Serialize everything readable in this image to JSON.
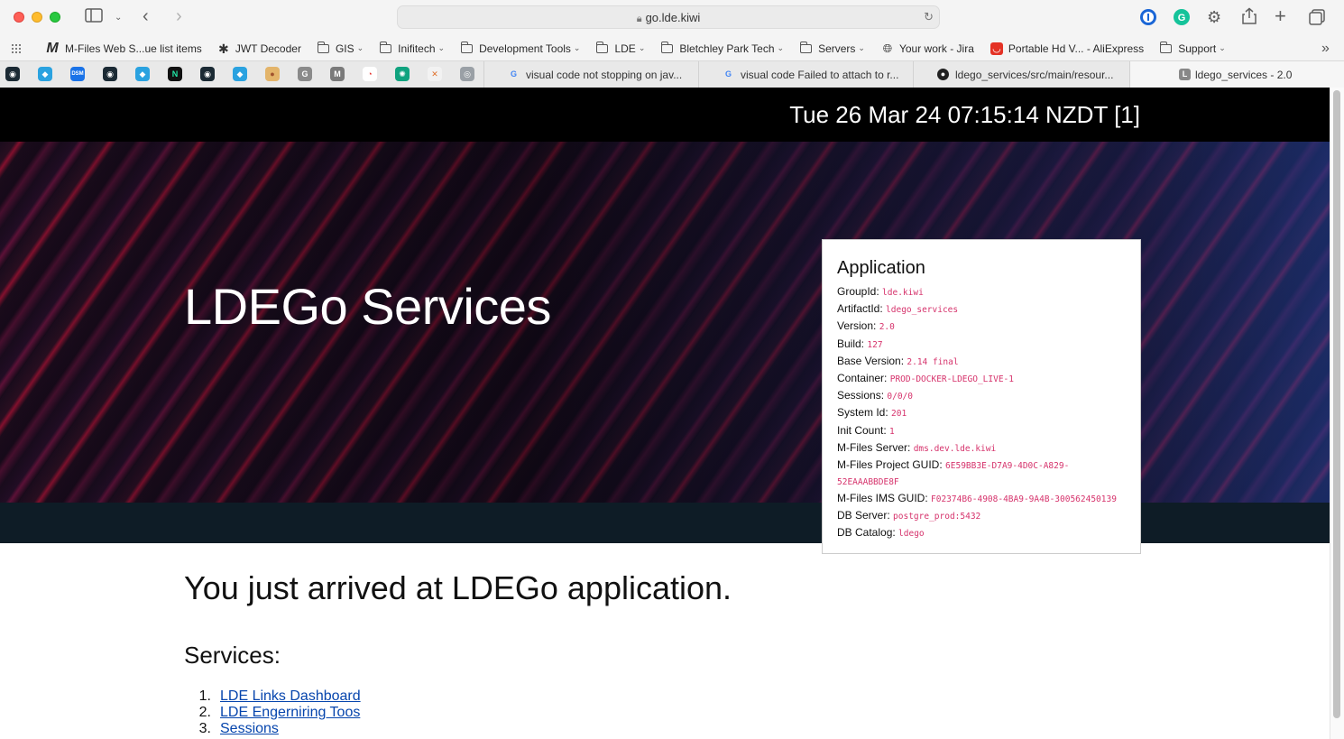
{
  "browser": {
    "url": "go.lde.kiwi",
    "bookmarks": [
      {
        "label": "M-Files Web S...ue list items",
        "icon": "m-files-logo-icon",
        "folder": false
      },
      {
        "label": "JWT Decoder",
        "icon": "jwt-icon",
        "folder": false
      },
      {
        "label": "GIS",
        "folder": true
      },
      {
        "label": "Inifitech",
        "folder": true
      },
      {
        "label": "Development Tools",
        "folder": true
      },
      {
        "label": "LDE",
        "folder": true
      },
      {
        "label": "Bletchley Park Tech",
        "folder": true
      },
      {
        "label": "Servers",
        "folder": true
      },
      {
        "label": "Your work - Jira",
        "icon": "globe-icon",
        "folder": false
      },
      {
        "label": "Portable Hd V... - AliExpress",
        "icon": "aliexpress-icon",
        "folder": false
      },
      {
        "label": "Support",
        "folder": true
      }
    ],
    "pinned_tabs": [
      {
        "name": "pinned-tab-1",
        "color": "#1b2a34",
        "glyph": "◉"
      },
      {
        "name": "pinned-tab-2",
        "color": "#2aa2e0",
        "glyph": "◆"
      },
      {
        "name": "pinned-tab-3",
        "color": "#1a73e8",
        "glyph": "DSM"
      },
      {
        "name": "pinned-tab-4",
        "color": "#1b2a34",
        "glyph": "◉"
      },
      {
        "name": "pinned-tab-5",
        "color": "#2aa2e0",
        "glyph": "◆"
      },
      {
        "name": "pinned-tab-6",
        "color": "#111111",
        "glyph": "N"
      },
      {
        "name": "pinned-tab-7",
        "color": "#1b2a34",
        "glyph": "◉"
      },
      {
        "name": "pinned-tab-8",
        "color": "#2aa2e0",
        "glyph": "◆"
      },
      {
        "name": "pinned-tab-9",
        "color": "#e3b46a",
        "glyph": "●"
      },
      {
        "name": "pinned-tab-10",
        "color": "#8a8a8a",
        "glyph": "G"
      },
      {
        "name": "pinned-tab-11",
        "color": "#7a7a7a",
        "glyph": "M"
      },
      {
        "name": "pinned-tab-12",
        "color": "#ffffff",
        "glyph": "◔"
      },
      {
        "name": "pinned-tab-13",
        "color": "#10a37f",
        "glyph": "✺"
      },
      {
        "name": "pinned-tab-14",
        "color": "#f2f2f2",
        "glyph": "✕"
      },
      {
        "name": "pinned-tab-15",
        "color": "#9aa0a6",
        "glyph": "◎"
      }
    ],
    "tabs": [
      {
        "label": "visual code not stopping on jav...",
        "favicon": "google-icon",
        "active": false
      },
      {
        "label": "visual code Failed to attach to r...",
        "favicon": "google-icon",
        "active": false
      },
      {
        "label": "ldego_services/src/main/resour...",
        "favicon": "github-icon",
        "active": false
      },
      {
        "label": "ldego_services - 2.0",
        "favicon": "letter-l-icon",
        "active": true
      }
    ]
  },
  "page": {
    "datetime": "Tue 26 Mar 24 07:15:14 NZDT [1]",
    "hero_title": "LDEGo Services",
    "application": {
      "title": "Application",
      "rows": [
        {
          "label": "GroupId:",
          "value": "lde.kiwi"
        },
        {
          "label": "ArtifactId:",
          "value": "ldego_services"
        },
        {
          "label": "Version:",
          "value": "2.0"
        },
        {
          "label": "Build:",
          "value": "127"
        },
        {
          "label": "Base Version:",
          "value": "2.14 final"
        },
        {
          "label": "Container:",
          "value": "PROD-DOCKER-LDEGO_LIVE-1"
        },
        {
          "label": "Sessions:",
          "value": "0/0/0"
        },
        {
          "label": "System Id:",
          "value": "201"
        },
        {
          "label": "Init Count:",
          "value": "1"
        },
        {
          "label": "M-Files Server:",
          "value": "dms.dev.lde.kiwi"
        },
        {
          "label": "M-Files Project GUID:",
          "value": "6E59BB3E-D7A9-4D0C-A829-52EAAABBDE8F"
        },
        {
          "label": "M-Files IMS GUID:",
          "value": "F02374B6-4908-4BA9-9A4B-300562450139"
        },
        {
          "label": "DB Server:",
          "value": "postgre_prod:5432"
        },
        {
          "label": "DB Catalog:",
          "value": "ldego"
        }
      ]
    },
    "welcome": "You just arrived at LDEGo application.",
    "services_heading": "Services:",
    "services": [
      {
        "num": "1.",
        "label": "LDE Links Dashboard"
      },
      {
        "num": "2.",
        "label": "LDE Engerniring Toos"
      },
      {
        "num": "3.",
        "label": "Sessions"
      }
    ]
  },
  "colors": {
    "accent_value": "#d6336c",
    "link": "#0645ad",
    "header_bg": "#000000",
    "band_bg": "#0e1c26"
  }
}
